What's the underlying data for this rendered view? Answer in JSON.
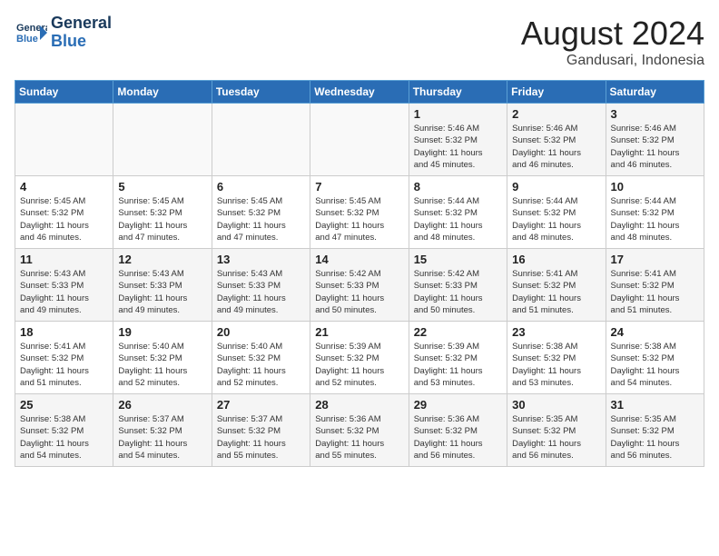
{
  "header": {
    "logo_line1": "General",
    "logo_line2": "Blue",
    "month_year": "August 2024",
    "location": "Gandusari, Indonesia"
  },
  "days_of_week": [
    "Sunday",
    "Monday",
    "Tuesday",
    "Wednesday",
    "Thursday",
    "Friday",
    "Saturday"
  ],
  "weeks": [
    [
      {
        "day": "",
        "info": ""
      },
      {
        "day": "",
        "info": ""
      },
      {
        "day": "",
        "info": ""
      },
      {
        "day": "",
        "info": ""
      },
      {
        "day": "1",
        "info": "Sunrise: 5:46 AM\nSunset: 5:32 PM\nDaylight: 11 hours\nand 45 minutes."
      },
      {
        "day": "2",
        "info": "Sunrise: 5:46 AM\nSunset: 5:32 PM\nDaylight: 11 hours\nand 46 minutes."
      },
      {
        "day": "3",
        "info": "Sunrise: 5:46 AM\nSunset: 5:32 PM\nDaylight: 11 hours\nand 46 minutes."
      }
    ],
    [
      {
        "day": "4",
        "info": "Sunrise: 5:45 AM\nSunset: 5:32 PM\nDaylight: 11 hours\nand 46 minutes."
      },
      {
        "day": "5",
        "info": "Sunrise: 5:45 AM\nSunset: 5:32 PM\nDaylight: 11 hours\nand 47 minutes."
      },
      {
        "day": "6",
        "info": "Sunrise: 5:45 AM\nSunset: 5:32 PM\nDaylight: 11 hours\nand 47 minutes."
      },
      {
        "day": "7",
        "info": "Sunrise: 5:45 AM\nSunset: 5:32 PM\nDaylight: 11 hours\nand 47 minutes."
      },
      {
        "day": "8",
        "info": "Sunrise: 5:44 AM\nSunset: 5:32 PM\nDaylight: 11 hours\nand 48 minutes."
      },
      {
        "day": "9",
        "info": "Sunrise: 5:44 AM\nSunset: 5:32 PM\nDaylight: 11 hours\nand 48 minutes."
      },
      {
        "day": "10",
        "info": "Sunrise: 5:44 AM\nSunset: 5:32 PM\nDaylight: 11 hours\nand 48 minutes."
      }
    ],
    [
      {
        "day": "11",
        "info": "Sunrise: 5:43 AM\nSunset: 5:33 PM\nDaylight: 11 hours\nand 49 minutes."
      },
      {
        "day": "12",
        "info": "Sunrise: 5:43 AM\nSunset: 5:33 PM\nDaylight: 11 hours\nand 49 minutes."
      },
      {
        "day": "13",
        "info": "Sunrise: 5:43 AM\nSunset: 5:33 PM\nDaylight: 11 hours\nand 49 minutes."
      },
      {
        "day": "14",
        "info": "Sunrise: 5:42 AM\nSunset: 5:33 PM\nDaylight: 11 hours\nand 50 minutes."
      },
      {
        "day": "15",
        "info": "Sunrise: 5:42 AM\nSunset: 5:33 PM\nDaylight: 11 hours\nand 50 minutes."
      },
      {
        "day": "16",
        "info": "Sunrise: 5:41 AM\nSunset: 5:32 PM\nDaylight: 11 hours\nand 51 minutes."
      },
      {
        "day": "17",
        "info": "Sunrise: 5:41 AM\nSunset: 5:32 PM\nDaylight: 11 hours\nand 51 minutes."
      }
    ],
    [
      {
        "day": "18",
        "info": "Sunrise: 5:41 AM\nSunset: 5:32 PM\nDaylight: 11 hours\nand 51 minutes."
      },
      {
        "day": "19",
        "info": "Sunrise: 5:40 AM\nSunset: 5:32 PM\nDaylight: 11 hours\nand 52 minutes."
      },
      {
        "day": "20",
        "info": "Sunrise: 5:40 AM\nSunset: 5:32 PM\nDaylight: 11 hours\nand 52 minutes."
      },
      {
        "day": "21",
        "info": "Sunrise: 5:39 AM\nSunset: 5:32 PM\nDaylight: 11 hours\nand 52 minutes."
      },
      {
        "day": "22",
        "info": "Sunrise: 5:39 AM\nSunset: 5:32 PM\nDaylight: 11 hours\nand 53 minutes."
      },
      {
        "day": "23",
        "info": "Sunrise: 5:38 AM\nSunset: 5:32 PM\nDaylight: 11 hours\nand 53 minutes."
      },
      {
        "day": "24",
        "info": "Sunrise: 5:38 AM\nSunset: 5:32 PM\nDaylight: 11 hours\nand 54 minutes."
      }
    ],
    [
      {
        "day": "25",
        "info": "Sunrise: 5:38 AM\nSunset: 5:32 PM\nDaylight: 11 hours\nand 54 minutes."
      },
      {
        "day": "26",
        "info": "Sunrise: 5:37 AM\nSunset: 5:32 PM\nDaylight: 11 hours\nand 54 minutes."
      },
      {
        "day": "27",
        "info": "Sunrise: 5:37 AM\nSunset: 5:32 PM\nDaylight: 11 hours\nand 55 minutes."
      },
      {
        "day": "28",
        "info": "Sunrise: 5:36 AM\nSunset: 5:32 PM\nDaylight: 11 hours\nand 55 minutes."
      },
      {
        "day": "29",
        "info": "Sunrise: 5:36 AM\nSunset: 5:32 PM\nDaylight: 11 hours\nand 56 minutes."
      },
      {
        "day": "30",
        "info": "Sunrise: 5:35 AM\nSunset: 5:32 PM\nDaylight: 11 hours\nand 56 minutes."
      },
      {
        "day": "31",
        "info": "Sunrise: 5:35 AM\nSunset: 5:32 PM\nDaylight: 11 hours\nand 56 minutes."
      }
    ]
  ]
}
